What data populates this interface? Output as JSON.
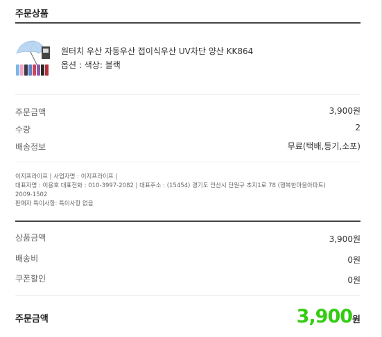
{
  "order_products": {
    "title": "주문상품",
    "product_name": "원터치 우산 자동우산 접이식우산 UV차단 양산 KK864",
    "option": "옵션 : 색상: 블랙"
  },
  "order_summary": {
    "rows": [
      {
        "label": "주문금액",
        "value": "3,900원"
      },
      {
        "label": "수량",
        "value": "2"
      },
      {
        "label": "배송정보",
        "value": "무료(택배,등기,소포)"
      }
    ]
  },
  "seller_info": {
    "line1": "이지프라이프 | 사업자명 : 이지프라이프 |",
    "line2": "대표자명 : 이용호 대표전화 : 010-3997-2082 | 대표주소 : (15454) 경기도 안산시 단원구 초지1로 78 (행복한마을아파트)",
    "line3": "2009-1502",
    "line4": "판매자 특이사항: 특이사항 없음"
  },
  "price_breakdown": {
    "rows": [
      {
        "label": "상품금액",
        "value": "3,900원"
      },
      {
        "label": "배송비",
        "value": "0원"
      },
      {
        "label": "쿠폰할인",
        "value": "0원"
      }
    ]
  },
  "order_total": {
    "label": "주문금액",
    "amount": "3,900",
    "unit": "원",
    "amount_color": "#33cc11"
  }
}
